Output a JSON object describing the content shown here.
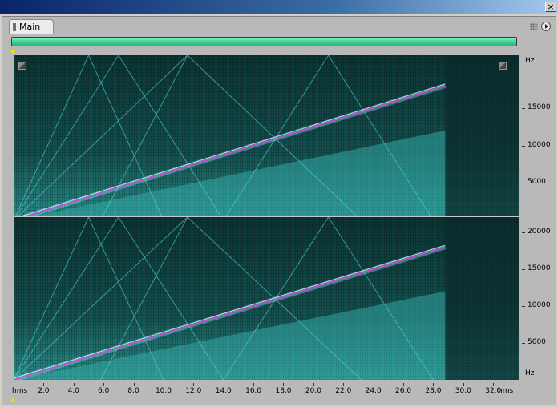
{
  "window": {
    "close_label": "×"
  },
  "tab": {
    "label": "Main"
  },
  "progress": {
    "fraction": 1.0,
    "color": "#3ed493"
  },
  "spectrogram": {
    "channels": 2,
    "color_scheme": "cyan",
    "xlim": [
      0.0,
      33.7
    ],
    "ylim": [
      0,
      22050
    ],
    "sweep_end_time": 28.8,
    "sweep_end_hz": 18000
  },
  "channel1_axis": {
    "unit": "Hz",
    "ticks": [
      {
        "value": 15000,
        "label": "15000"
      },
      {
        "value": 10000,
        "label": "10000"
      },
      {
        "value": 5000,
        "label": "5000"
      }
    ]
  },
  "channel2_axis": {
    "unit": "Hz",
    "ticks": [
      {
        "value": 20000,
        "label": "20000"
      },
      {
        "value": 15000,
        "label": "15000"
      },
      {
        "value": 10000,
        "label": "10000"
      },
      {
        "value": 5000,
        "label": "5000"
      }
    ]
  },
  "time_axis": {
    "unit": "hms",
    "ticks": [
      {
        "value": 2.0,
        "label": "2.0"
      },
      {
        "value": 4.0,
        "label": "4.0"
      },
      {
        "value": 6.0,
        "label": "6.0"
      },
      {
        "value": 8.0,
        "label": "8.0"
      },
      {
        "value": 10.0,
        "label": "10.0"
      },
      {
        "value": 12.0,
        "label": "12.0"
      },
      {
        "value": 14.0,
        "label": "14.0"
      },
      {
        "value": 16.0,
        "label": "16.0"
      },
      {
        "value": 18.0,
        "label": "18.0"
      },
      {
        "value": 20.0,
        "label": "20.0"
      },
      {
        "value": 22.0,
        "label": "22.0"
      },
      {
        "value": 24.0,
        "label": "24.0"
      },
      {
        "value": 26.0,
        "label": "26.0"
      },
      {
        "value": 28.0,
        "label": "28.0"
      },
      {
        "value": 30.0,
        "label": "30.0"
      },
      {
        "value": 32.0,
        "label": "32.0"
      }
    ]
  }
}
